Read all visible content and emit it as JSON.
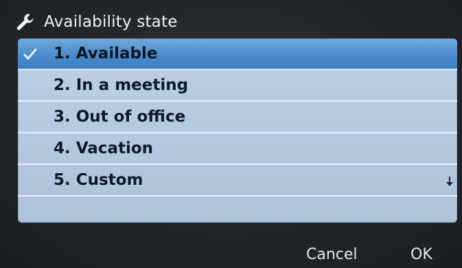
{
  "header": {
    "title": "Availability state",
    "icon": "wrench-icon"
  },
  "list": {
    "selected_index": 0,
    "items": [
      {
        "label": "1.  Available",
        "checked": true
      },
      {
        "label": "2.  In a meeting",
        "checked": false
      },
      {
        "label": "3.  Out of office",
        "checked": false
      },
      {
        "label": "4.  Vacation",
        "checked": false
      },
      {
        "label": "5.  Custom",
        "checked": false
      }
    ],
    "scroll_icon": "arrow-down-icon"
  },
  "softkeys": {
    "cancel_label": "Cancel",
    "ok_label": "OK"
  },
  "colors": {
    "selection": "#4a8ccc",
    "list_background": "#b8cde4",
    "screen_background": "#202428"
  }
}
